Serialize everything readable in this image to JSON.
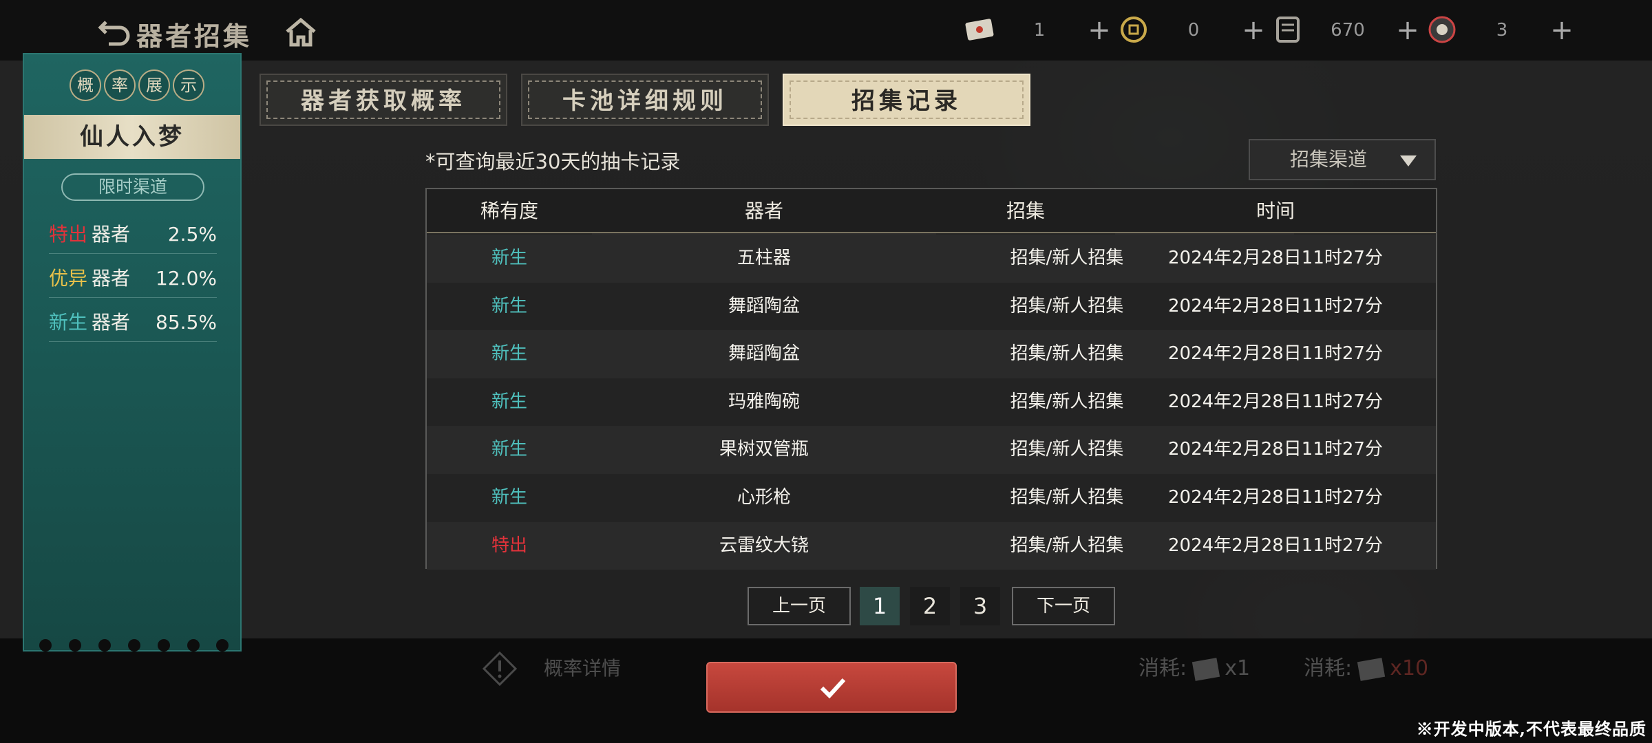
{
  "header": {
    "title": "器者招集",
    "resources": [
      {
        "icon": "ticket-icon",
        "value": "1"
      },
      {
        "icon": "coin-icon",
        "value": "0"
      },
      {
        "icon": "scroll-icon",
        "value": "670"
      },
      {
        "icon": "gem-icon",
        "value": "3"
      }
    ],
    "plus_label": "+"
  },
  "left_panel": {
    "badges": [
      "概",
      "率",
      "展",
      "示"
    ],
    "pool_name": "仙人入梦",
    "channel": "限时渠道",
    "rates": [
      {
        "rarity": "特出",
        "kind": "器者",
        "percent": "2.5%",
        "color": "#e2323a"
      },
      {
        "rarity": "优异",
        "kind": "器者",
        "percent": "12.0%",
        "color": "#e6c04a"
      },
      {
        "rarity": "新生",
        "kind": "器者",
        "percent": "85.5%",
        "color": "#4fc0bd"
      }
    ]
  },
  "tabs": [
    {
      "label": "器者获取概率",
      "active": false
    },
    {
      "label": "卡池详细规则",
      "active": false
    },
    {
      "label": "招集记录",
      "active": true
    }
  ],
  "content": {
    "hint": "*可查询最近30天的抽卡记录",
    "filter": {
      "label": "招集渠道"
    },
    "table": {
      "headers": [
        "稀有度",
        "器者",
        "招集",
        "时间"
      ],
      "rows": [
        {
          "rarity": "新生",
          "name": "五柱器",
          "source": "招集/新人招集",
          "time": "2024年2月28日11时27分"
        },
        {
          "rarity": "新生",
          "name": "舞蹈陶盆",
          "source": "招集/新人招集",
          "time": "2024年2月28日11时27分"
        },
        {
          "rarity": "新生",
          "name": "舞蹈陶盆",
          "source": "招集/新人招集",
          "time": "2024年2月28日11时27分"
        },
        {
          "rarity": "新生",
          "name": "玛雅陶碗",
          "source": "招集/新人招集",
          "time": "2024年2月28日11时27分"
        },
        {
          "rarity": "新生",
          "name": "果树双管瓶",
          "source": "招集/新人招集",
          "time": "2024年2月28日11时27分"
        },
        {
          "rarity": "新生",
          "name": "心形枪",
          "source": "招集/新人招集",
          "time": "2024年2月28日11时27分"
        },
        {
          "rarity": "特出",
          "name": "云雷纹大铙",
          "source": "招集/新人招集",
          "time": "2024年2月28日11时27分"
        }
      ]
    },
    "pagination": {
      "prev": "上一页",
      "next": "下一页",
      "pages": [
        "1",
        "2",
        "3"
      ],
      "current": "1"
    }
  },
  "footer": {
    "prob_detail": "概率详情",
    "cost_single": "消耗:",
    "cost_single_qty": "x1",
    "cost_multi": "消耗:",
    "cost_multi_qty": "x10",
    "watermark": "※开发中版本,不代表最终品质"
  },
  "colors": {
    "accent_teal": "#1f6561",
    "confirm_red": "#b83d34",
    "rarity_new": "#4fc0bd",
    "rarity_special": "#e2323a",
    "rarity_excellent": "#e6c04a"
  }
}
